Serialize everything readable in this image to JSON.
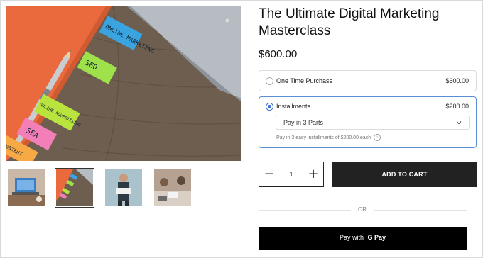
{
  "product": {
    "title": "The Ultimate Digital Marketing Masterclass",
    "price": "$600.00"
  },
  "main_image": {
    "notes": [
      "ONLINE MARKETING",
      "SEO",
      "ONLINE ADVERTISING",
      "SEA",
      "CONTENT"
    ]
  },
  "thumbnails": [
    {
      "name": "laptop-desk"
    },
    {
      "name": "sticky-notes",
      "selected": true
    },
    {
      "name": "presenter"
    },
    {
      "name": "meeting"
    }
  ],
  "purchase_options": {
    "one_time": {
      "label": "One Time Purchase",
      "price": "$600.00"
    },
    "installments": {
      "label": "Installments",
      "price": "$200.00",
      "selected_plan": "Pay in 3 Parts",
      "note": "Pay in 3 easy installments of $200.00 each",
      "info_icon": "i"
    }
  },
  "quantity": {
    "minus": "−",
    "value": "1",
    "plus": "+"
  },
  "cart": {
    "label": "ADD TO CART"
  },
  "divider": {
    "label": "OR"
  },
  "gpay": {
    "prefix": "Pay with",
    "logo_g": "G",
    "logo_text": "Pay"
  },
  "colors": {
    "accent": "#3a6fd0",
    "button_dark": "#222222"
  }
}
